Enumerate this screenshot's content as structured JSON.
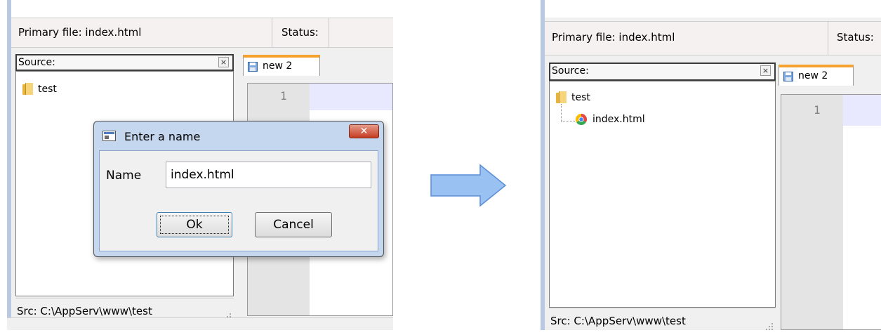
{
  "before": {
    "header": {
      "primary_file": "Primary file: index.html",
      "status_label": "Status:"
    },
    "source_panel": {
      "title": "Source:",
      "close_glyph": "×",
      "items": [
        {
          "label": "test",
          "icon": "folder-icon"
        }
      ],
      "status": "Src: C:\\AppServ\\www\\test"
    },
    "editor": {
      "tab_label": "new 2",
      "line_numbers": [
        "1"
      ]
    },
    "dialog": {
      "title": "Enter a name",
      "close_glyph": "✕",
      "field_label": "Name",
      "field_value": "index.html",
      "ok_label": "Ok",
      "cancel_label": "Cancel"
    }
  },
  "after": {
    "header": {
      "primary_file": "Primary file: index.html",
      "status_label": "Status:"
    },
    "source_panel": {
      "title": "Source:",
      "close_glyph": "×",
      "items": [
        {
          "label": "test",
          "icon": "folder-icon"
        },
        {
          "label": "index.html",
          "icon": "chrome-icon"
        }
      ],
      "status": "Src: C:\\AppServ\\www\\test"
    },
    "editor": {
      "tab_label": "new 2",
      "line_numbers": [
        "1"
      ]
    }
  },
  "colors": {
    "tab_accent": "#f5a22e",
    "dialog_frame": "#c5d7ee",
    "close_red": "#c63c22",
    "arrow_fill": "#99c2f2",
    "arrow_stroke": "#5b8dd6",
    "current_line": "#e8e8ff"
  }
}
